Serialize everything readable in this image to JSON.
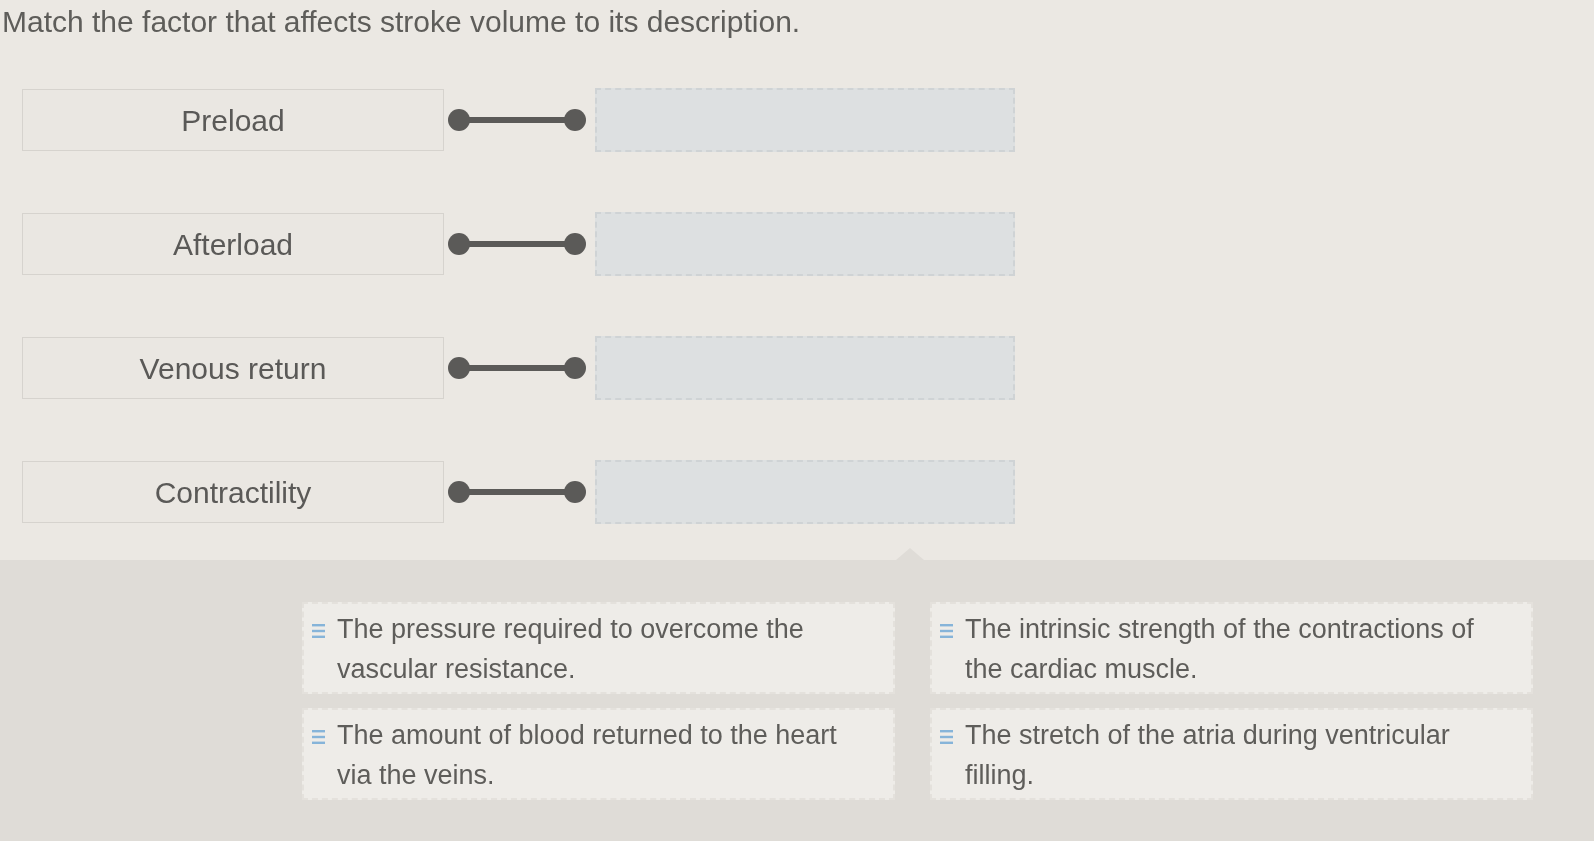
{
  "instruction": "Match the factor that affects stroke volume to its description.",
  "terms": [
    {
      "label": "Preload"
    },
    {
      "label": "Afterload"
    },
    {
      "label": "Venous return"
    },
    {
      "label": "Contractility"
    }
  ],
  "answer_bank": {
    "columns": [
      [
        {
          "text": "The pressure required to overcome the vascular resistance."
        },
        {
          "text": "The amount of blood returned to the heart via the veins."
        }
      ],
      [
        {
          "text": "The intrinsic strength of the contractions of the cardiac muscle."
        },
        {
          "text": "The stretch of the atria during ventricular filling."
        }
      ]
    ]
  }
}
